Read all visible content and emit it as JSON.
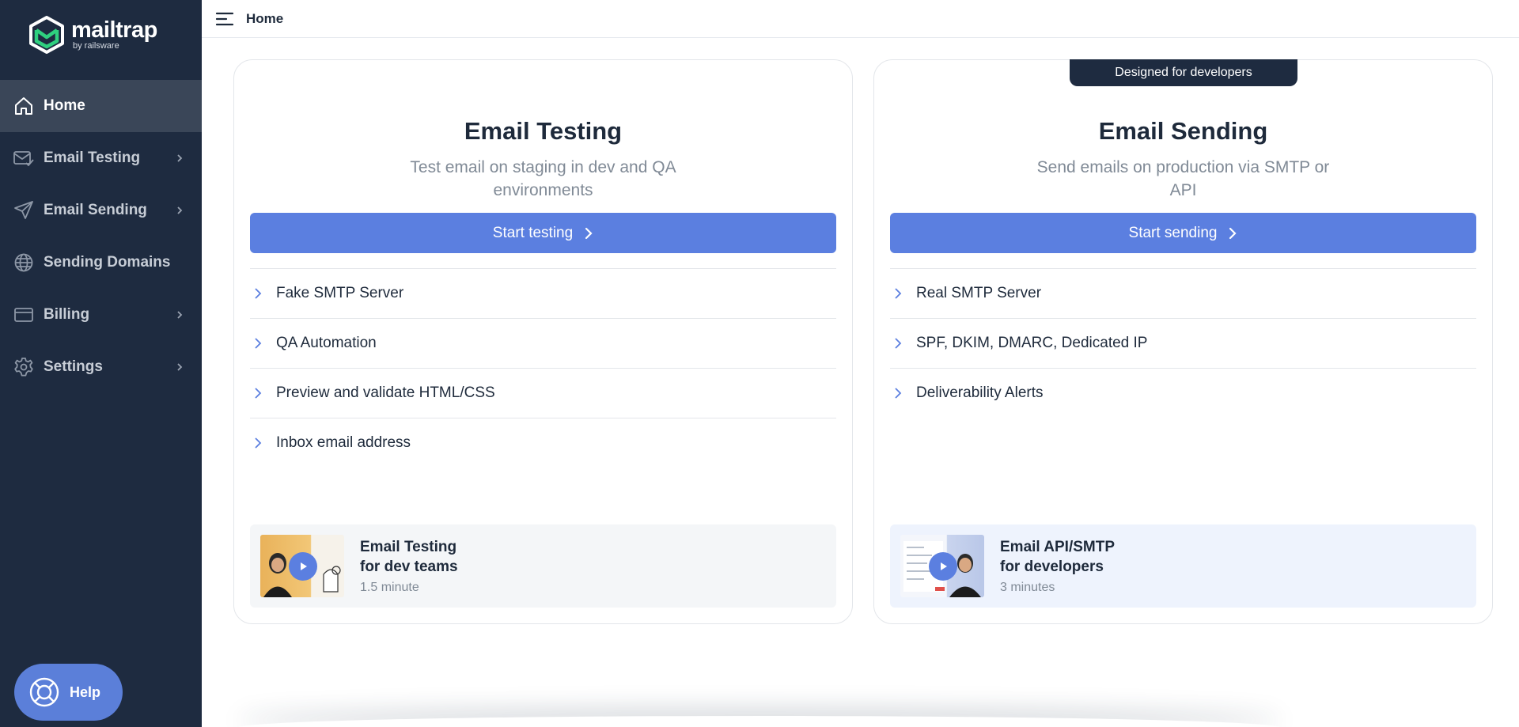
{
  "brand": {
    "name": "mailtrap",
    "byline": "by railsware",
    "sidebar_color": "#1e2b40",
    "accent_color": "#5b7fe0"
  },
  "sidebar": {
    "items": [
      {
        "label": "Home",
        "icon": "home-icon",
        "active": true,
        "has_submenu": false
      },
      {
        "label": "Email Testing",
        "icon": "envelope-check-icon",
        "active": false,
        "has_submenu": true
      },
      {
        "label": "Email Sending",
        "icon": "paper-plane-icon",
        "active": false,
        "has_submenu": true
      },
      {
        "label": "Sending Domains",
        "icon": "globe-icon",
        "active": false,
        "has_submenu": false
      },
      {
        "label": "Billing",
        "icon": "credit-card-icon",
        "active": false,
        "has_submenu": true
      },
      {
        "label": "Settings",
        "icon": "gear-icon",
        "active": false,
        "has_submenu": true
      }
    ],
    "help_label": "Help"
  },
  "topbar": {
    "title": "Home"
  },
  "cards": {
    "testing": {
      "title": "Email Testing",
      "subtitle": "Test email on staging in dev and QA environments",
      "cta_label": "Start testing",
      "features": [
        "Fake SMTP Server",
        "QA Automation",
        "Preview and validate HTML/CSS",
        "Inbox email address"
      ],
      "video": {
        "title_line1": "Email Testing",
        "title_line2": "for dev teams",
        "duration": "1.5 minute"
      }
    },
    "sending": {
      "badge": "Designed for developers",
      "title": "Email Sending",
      "subtitle": "Send emails on production via SMTP or API",
      "cta_label": "Start sending",
      "features": [
        "Real SMTP Server",
        "SPF, DKIM, DMARC, Dedicated IP",
        "Deliverability Alerts"
      ],
      "video": {
        "title_line1": "Email API/SMTP",
        "title_line2": "for developers",
        "duration": "3 minutes"
      }
    }
  }
}
